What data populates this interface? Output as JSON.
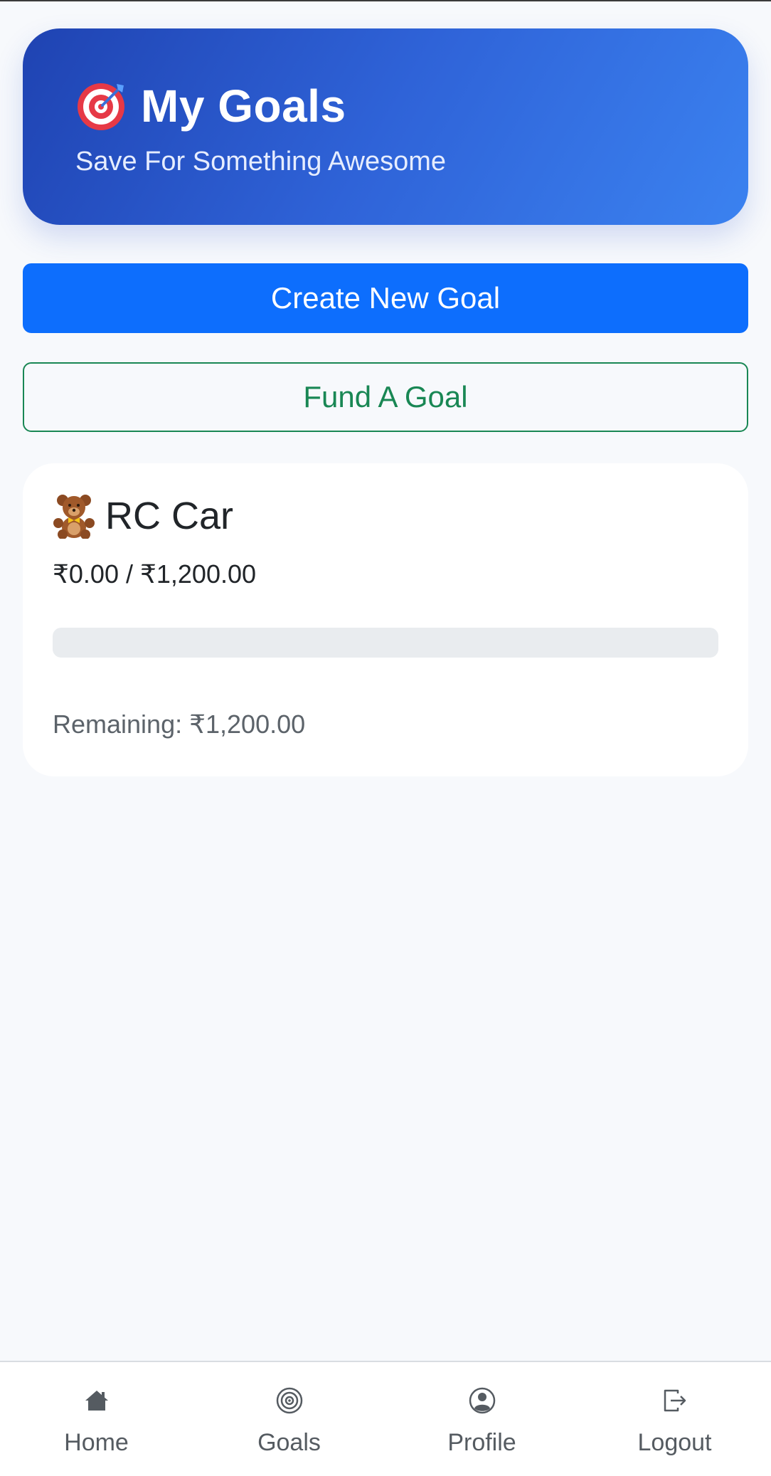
{
  "header": {
    "title": "My Goals",
    "subtitle": "Save For Something Awesome",
    "icon": "target-icon"
  },
  "actions": {
    "create_label": "Create New Goal",
    "fund_label": "Fund A Goal"
  },
  "goals": [
    {
      "icon": "teddy-bear-icon",
      "name": "RC Car",
      "amount_text": "₹0.00 / ₹1,200.00",
      "progress_fraction": 0.0,
      "remaining_text": "Remaining: ₹1,200.00"
    }
  ],
  "nav": {
    "items": [
      {
        "label": "Home",
        "icon": "home-icon"
      },
      {
        "label": "Goals",
        "icon": "target-icon"
      },
      {
        "label": "Profile",
        "icon": "profile-icon"
      },
      {
        "label": "Logout",
        "icon": "logout-icon"
      }
    ]
  },
  "colors": {
    "primary": "#0d6efd",
    "success": "#198754",
    "hero_start": "#1f43b2",
    "hero_end": "#3b82f0"
  }
}
